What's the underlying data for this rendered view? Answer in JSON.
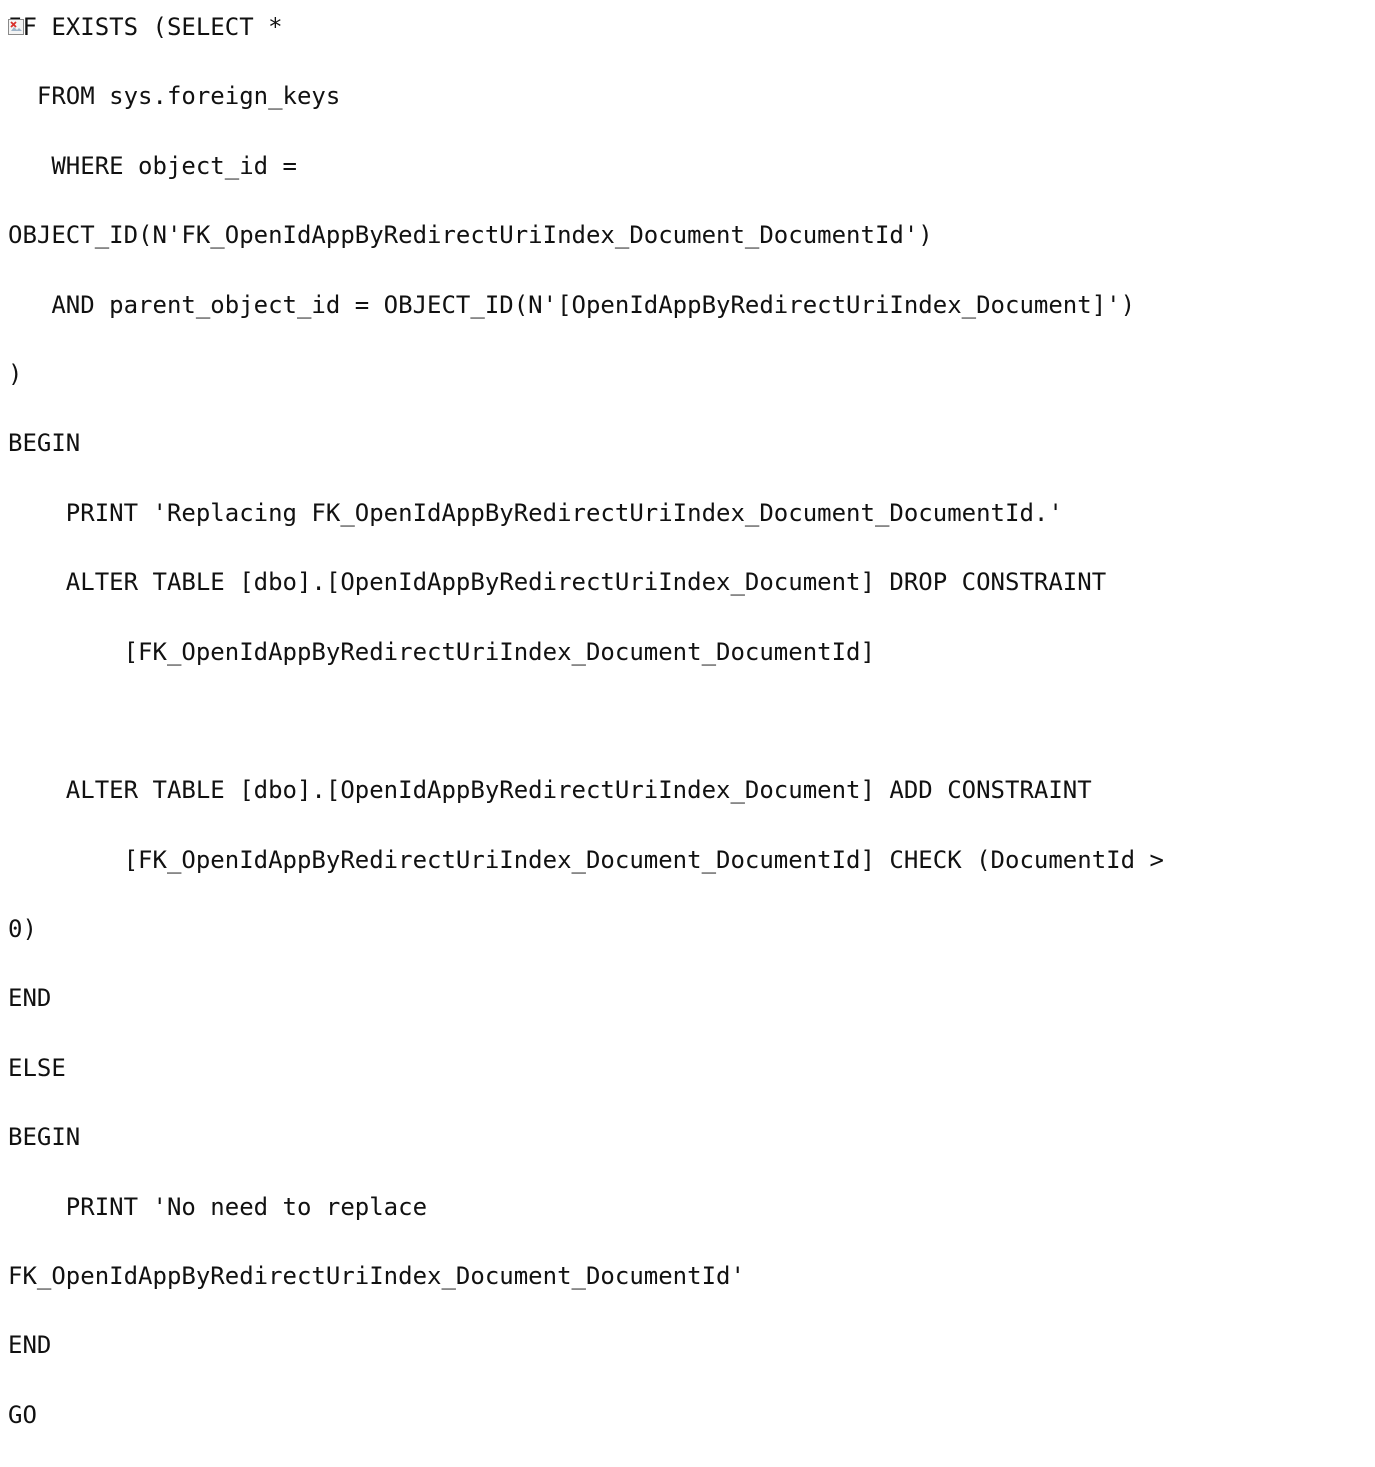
{
  "document": {
    "lines": [
      "IF EXISTS (SELECT *",
      "  FROM sys.foreign_keys",
      "   WHERE object_id =",
      "OBJECT_ID(N'FK_OpenIdAppByRedirectUriIndex_Document_DocumentId')",
      "   AND parent_object_id = OBJECT_ID(N'[OpenIdAppByRedirectUriIndex_Document]')",
      ")",
      "BEGIN",
      "    PRINT 'Replacing FK_OpenIdAppByRedirectUriIndex_Document_DocumentId.'",
      "    ALTER TABLE [dbo].[OpenIdAppByRedirectUriIndex_Document] DROP CONSTRAINT",
      "        [FK_OpenIdAppByRedirectUriIndex_Document_DocumentId]",
      "",
      "    ALTER TABLE [dbo].[OpenIdAppByRedirectUriIndex_Document] ADD CONSTRAINT",
      "        [FK_OpenIdAppByRedirectUriIndex_Document_DocumentId] CHECK (DocumentId >",
      "0)",
      "END",
      "ELSE",
      "BEGIN",
      "    PRINT 'No need to replace",
      "FK_OpenIdAppByRedirectUriIndex_Document_DocumentId'",
      "END",
      "GO"
    ]
  },
  "icons": {
    "broken_image": "broken-image-icon"
  },
  "colors": {
    "text": "#111111",
    "background": "#ffffff",
    "icon_accent": "#d9302b"
  }
}
